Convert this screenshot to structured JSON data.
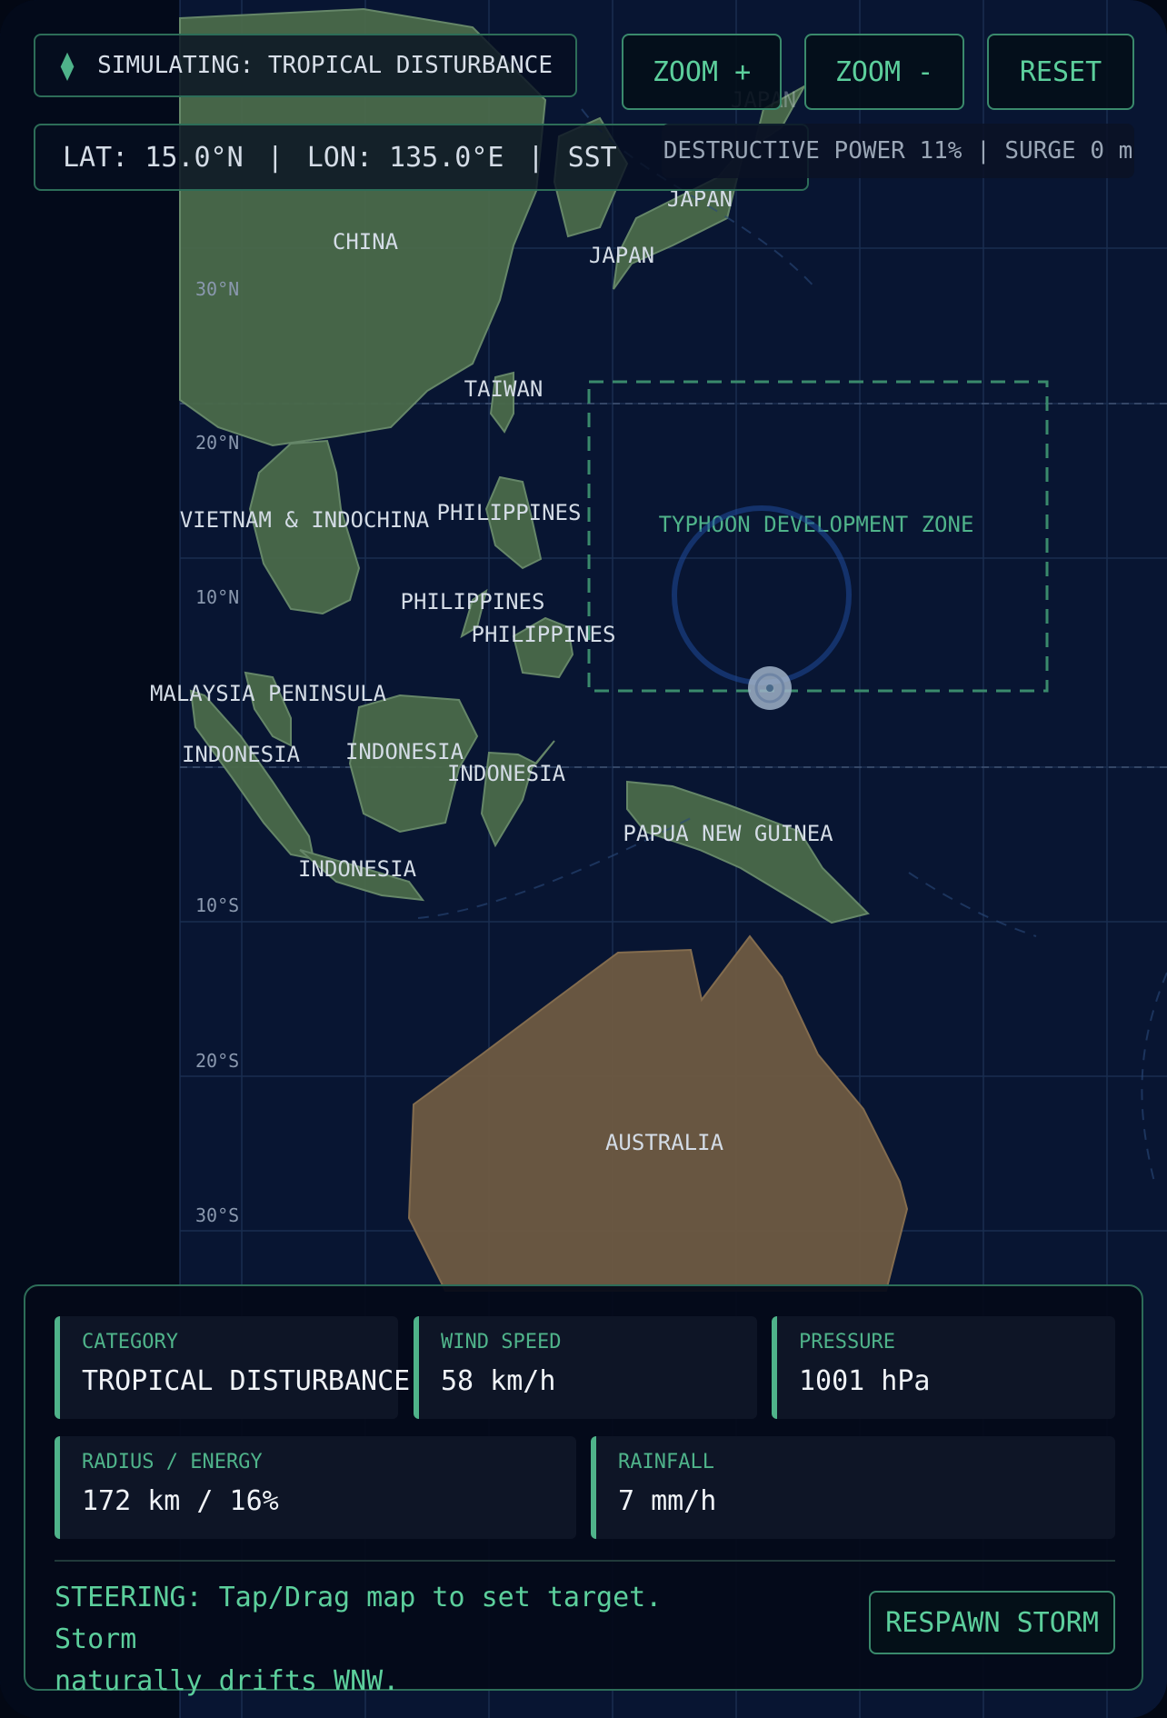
{
  "status": {
    "compass_icon": "compass-icon",
    "text": "SIMULATING: TROPICAL DISTURBANCE"
  },
  "coords": {
    "lat": "LAT: 15.0°N",
    "sep1": "|",
    "lon": "LON: 135.0°E",
    "sep2": "|",
    "sst": "SST"
  },
  "power": {
    "text": "DESTRUCTIVE POWER 11% | SURGE 0 m"
  },
  "buttons": {
    "zoom_in": "ZOOM +",
    "zoom_out": "ZOOM -",
    "reset": "RESET",
    "respawn": "RESPAWN STORM"
  },
  "map": {
    "lat_labels": [
      "30°N",
      "20°N",
      "10°N",
      "10°S",
      "20°S",
      "30°S"
    ],
    "regions": {
      "china": "CHINA",
      "japan_1": "JAPAN",
      "japan_2": "JAPAN",
      "japan_3": "JAPAN",
      "taiwan": "TAIWAN",
      "vietnam": "VIETNAM & INDOCHINA",
      "philippines_1": "PHILIPPINES",
      "philippines_2": "PHILIPPINES",
      "philippines_3": "PHILIPPINES",
      "malaysia": "MALAYSIA PENINSULA",
      "indonesia_1": "INDONESIA",
      "indonesia_2": "INDONESIA",
      "indonesia_3": "INDONESIA",
      "indonesia_4": "INDONESIA",
      "png": "PAPUA NEW GUINEA",
      "australia": "AUSTRALIA"
    },
    "zone_label": "TYPHOON DEVELOPMENT ZONE",
    "colors": {
      "ocean": "#061029",
      "land": "#4a6a4a",
      "australia": "#6e5a42",
      "accent": "#4fb38a"
    }
  },
  "stats": {
    "category": {
      "label": "CATEGORY",
      "value": "TROPICAL DISTURBANCE"
    },
    "wind": {
      "label": "WIND SPEED",
      "value": "58 km/h"
    },
    "pressure": {
      "label": "PRESSURE",
      "value": "1001 hPa"
    },
    "radius": {
      "label": "RADIUS / ENERGY",
      "value": "172 km / 16%"
    },
    "rainfall": {
      "label": "RAINFALL",
      "value": "7 mm/h"
    }
  },
  "steering": {
    "line1": "STEERING: Tap/Drag map to set target. Storm",
    "line2": "naturally drifts WNW."
  }
}
